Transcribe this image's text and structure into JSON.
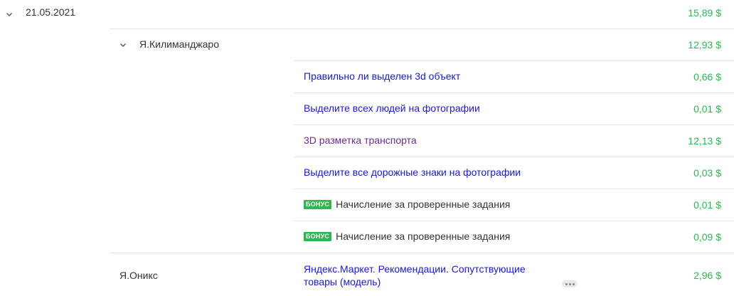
{
  "date_group": {
    "date": "21.05.2021",
    "total": "15,89 $"
  },
  "project_group": {
    "name": "Я.Килиманджаро",
    "total": "12,93 $"
  },
  "tasks": [
    {
      "title": "Правильно ли выделен 3d объект",
      "amount": "0,66 $",
      "visited": false,
      "bonus": false
    },
    {
      "title": "Выделите всех людей на фотографии",
      "amount": "0,01 $",
      "visited": false,
      "bonus": false
    },
    {
      "title": "3D разметка транспорта",
      "amount": "12,13 $",
      "visited": true,
      "bonus": false
    },
    {
      "title": "Выделите все дорожные знаки на фотографии",
      "amount": "0,03 $",
      "visited": false,
      "bonus": false
    },
    {
      "title": "Начисление за проверенные задания",
      "amount": "0,01 $",
      "visited": false,
      "bonus": true,
      "badge": "БОНУС"
    },
    {
      "title": "Начисление за проверенные задания",
      "amount": "0,09 $",
      "visited": false,
      "bonus": true,
      "badge": "БОНУС"
    }
  ],
  "second_project": {
    "name": "Я.Оникс",
    "task_title_line1": "Яндекс.Маркет. Рекомендации. Сопутствующие",
    "task_title_line2": "товары (модель)",
    "amount": "2,96 $"
  },
  "icons": {
    "expand": "chevron-down-icon",
    "more": "more-dots-icon"
  },
  "colors": {
    "amount_green": "#2fb552",
    "link_blue": "#1a1acc",
    "link_visited": "#6b2a8f",
    "badge_green": "#2fb552"
  }
}
